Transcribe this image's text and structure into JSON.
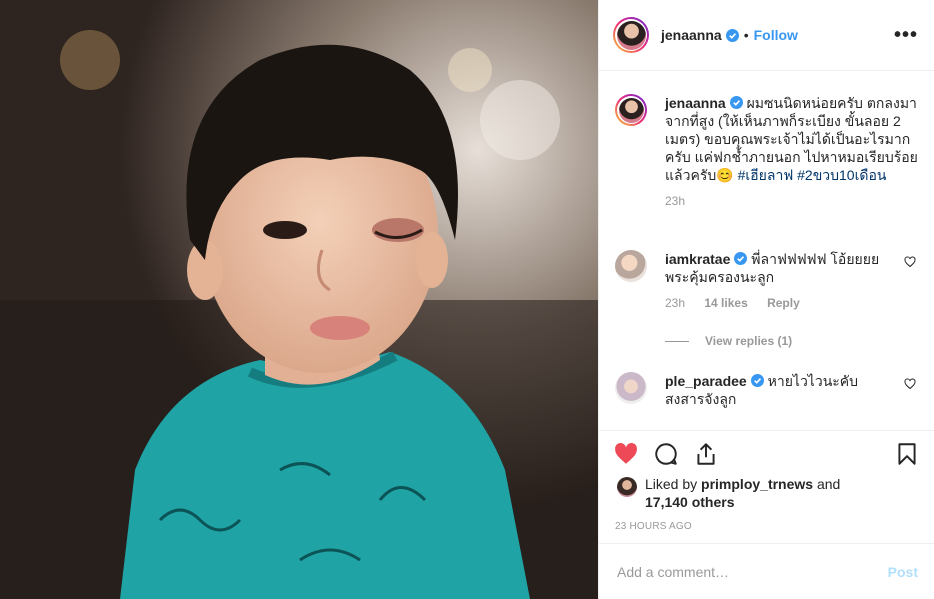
{
  "post": {
    "photo_alt": "",
    "author": {
      "username": "jenaanna",
      "verified": true,
      "follow_label": "Follow",
      "dot": "•",
      "more_label": "•••"
    },
    "caption": {
      "username": "jenaanna",
      "text": "ผมซนนิดหน่อยครับ ตกลงมาจากที่สูง (ให้เห็นภาพก็ระเบียง ขั้นลอย 2 เมตร) ขอบคุณพระเจ้าไม่ได้เป็นอะไรมากครับ แค่ฟกช้ำภายนอก ไปหาหมอเรียบร้อยแล้วครับ😊",
      "hashtags": "#เฮียลาฟ #2ขวบ10เดือน",
      "time": "23h"
    },
    "comments": [
      {
        "username": "iamkratae",
        "text": "พี่ลาฟฟฟฟฟ โอ้ยยยย พระคุ้มครองนะลูก",
        "time": "23h",
        "likes": "14 likes",
        "reply_label": "Reply",
        "view_replies": "View replies (1)"
      },
      {
        "username": "ple_paradee",
        "text": "หายไวไวนะคับ สงสารจังลูก"
      }
    ],
    "likes": {
      "prefix": "Liked by ",
      "user": "primploy_trnews",
      "middle": " and",
      "count": "17,140 others"
    },
    "timestamp": "23 HOURS AGO",
    "comment_input": {
      "placeholder": "Add a comment…"
    },
    "post_label": "Post",
    "colors": {
      "accent": "#3897f0",
      "liked": "#ed4956",
      "post_disabled": "#b2dffc"
    },
    "icons": [
      "heart-icon",
      "comment-icon",
      "share-icon",
      "bookmark-icon",
      "verified-icon",
      "more-icon"
    ]
  }
}
